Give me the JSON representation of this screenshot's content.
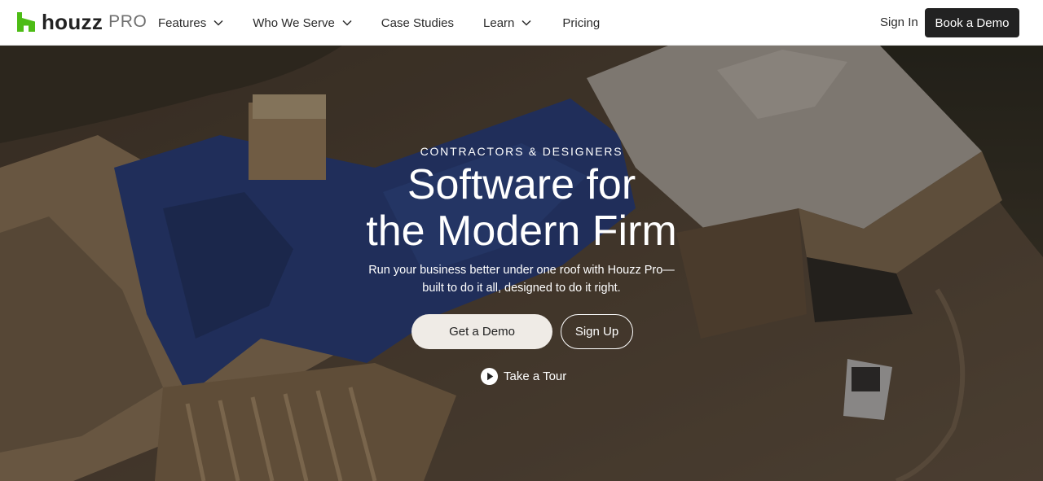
{
  "brand": {
    "wordmark": "houzz",
    "product": "PRO",
    "accent_color": "#4dbc15"
  },
  "nav": {
    "items": [
      {
        "label": "Features",
        "has_dropdown": true,
        "icon": "chevron-down-icon"
      },
      {
        "label": "Who We Serve",
        "has_dropdown": true,
        "icon": "chevron-down-icon"
      },
      {
        "label": "Case Studies",
        "has_dropdown": false
      },
      {
        "label": "Learn",
        "has_dropdown": true,
        "icon": "chevron-down-icon"
      },
      {
        "label": "Pricing",
        "has_dropdown": false
      }
    ],
    "sign_in": "Sign In",
    "book_demo": "Book a Demo"
  },
  "hero": {
    "eyebrow": "CONTRACTORS & DESIGNERS",
    "headline_line1": "Software for",
    "headline_line2": "the Modern Firm",
    "subtext_line1": "Run your business better under one roof with Houzz Pro—",
    "subtext_line2": "built to do it all, designed to do it right.",
    "primary_cta": "Get a Demo",
    "secondary_cta": "Sign Up",
    "tour_link": "Take a Tour",
    "tour_icon": "play-circle-icon"
  }
}
